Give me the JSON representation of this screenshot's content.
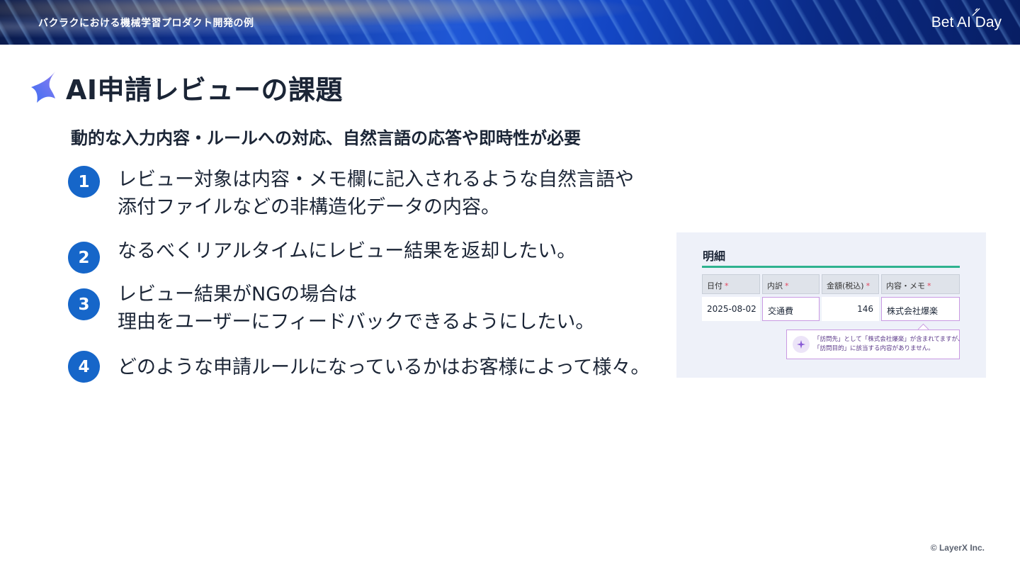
{
  "header": {
    "section_title": "バクラクにおける機械学習プロダクト開発の例",
    "brand": "Bet AI Day"
  },
  "slide": {
    "title": "AI申請レビューの課題",
    "subtitle": "動的な入力内容・ルールへの対応、自然言語の応答や即時性が必要",
    "items": [
      {
        "number": "1",
        "lines": [
          "レビュー対象は内容・メモ欄に記入されるような自然言語や",
          "添付ファイルなどの非構造化データの内容。"
        ]
      },
      {
        "number": "2",
        "lines": [
          "なるべくリアルタイムにレビュー結果を返却したい。"
        ]
      },
      {
        "number": "3",
        "lines": [
          "レビュー結果がNGの場合は",
          "理由をユーザーにフィードバックできるようにしたい。"
        ]
      },
      {
        "number": "4",
        "lines": [
          "どのような申請ルールになっているかはお客様によって様々。"
        ]
      }
    ]
  },
  "panel": {
    "heading": "明細",
    "columns": [
      "日付",
      "内訳",
      "金額(税込)",
      "内容・メモ"
    ],
    "required_mark": "*",
    "row": {
      "date": "2025-08-02",
      "category": "交通費",
      "amount": "146",
      "memo": "株式会社爆楽"
    },
    "tooltip_lines": [
      "「訪問先」として「株式会社爆楽」が含まれてますが、",
      "「訪問目的」に該当する内容がありません。"
    ],
    "tooltip_icon": "sparkle-icon"
  },
  "footer": {
    "copyright": "© LayerX Inc."
  },
  "colors": {
    "accent": "#1666c9",
    "rule": "#2fb38f",
    "highlight": "#c99ae2"
  }
}
